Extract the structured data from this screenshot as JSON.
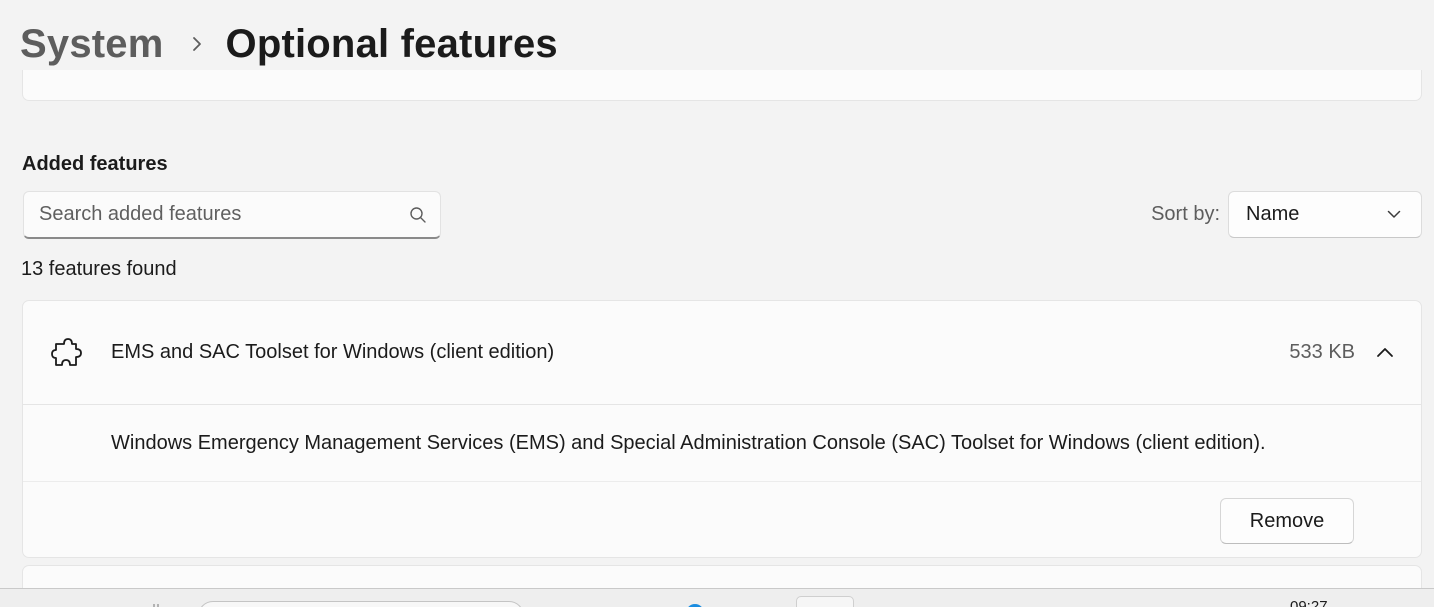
{
  "breadcrumb": {
    "parent": "System",
    "current": "Optional features"
  },
  "added_features": {
    "title": "Added features",
    "search_placeholder": "Search added features",
    "sort_label": "Sort by:",
    "sort_value": "Name",
    "count_text": "13 features found"
  },
  "feature": {
    "name": "EMS and SAC Toolset for Windows (client edition)",
    "size": "533 KB",
    "description": "Windows Emergency Management Services (EMS) and Special Administration Console (SAC) Toolset for Windows (client edition).",
    "remove_label": "Remove"
  },
  "taskbar": {
    "clock_partial": "09:27"
  },
  "colors": {
    "background": "#f3f3f3",
    "card": "#fbfbfb",
    "accent": "#1a8ce0"
  },
  "icons": {
    "breadcrumb_separator": "chevron-right-icon",
    "search": "search-icon",
    "sort_dropdown": "chevron-down-icon",
    "feature": "puzzle-icon",
    "collapse": "chevron-up-icon"
  }
}
